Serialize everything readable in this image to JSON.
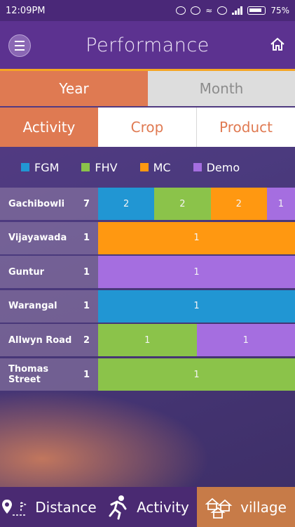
{
  "status": {
    "time": "12:09PM",
    "battery": "75%"
  },
  "header": {
    "title": "Performance"
  },
  "period_tabs": [
    {
      "label": "Year"
    },
    {
      "label": "Month"
    }
  ],
  "category_tabs": [
    {
      "label": "Activity"
    },
    {
      "label": "Crop"
    },
    {
      "label": "Product"
    }
  ],
  "legend": [
    {
      "label": "FGM",
      "color": "#2196d3"
    },
    {
      "label": "FHV",
      "color": "#8bc34a"
    },
    {
      "label": "MC",
      "color": "#ff9811"
    },
    {
      "label": "Demo",
      "color": "#a56ee0"
    }
  ],
  "chart_data": {
    "type": "bar",
    "categories": [
      "Gachibowli",
      "Vijayawada",
      "Guntur",
      "Warangal",
      "Allwyn Road",
      "Thomas Street"
    ],
    "totals": [
      7,
      1,
      1,
      1,
      2,
      1
    ],
    "series": [
      {
        "name": "FGM",
        "values": [
          2,
          0,
          0,
          1,
          0,
          0
        ]
      },
      {
        "name": "FHV",
        "values": [
          2,
          0,
          0,
          0,
          1,
          1
        ]
      },
      {
        "name": "MC",
        "values": [
          2,
          1,
          0,
          0,
          0,
          0
        ]
      },
      {
        "name": "Demo",
        "values": [
          1,
          0,
          1,
          0,
          1,
          0
        ]
      }
    ]
  },
  "bottom_nav": [
    {
      "label": "Distance"
    },
    {
      "label": "Activity"
    },
    {
      "label": "village"
    }
  ]
}
